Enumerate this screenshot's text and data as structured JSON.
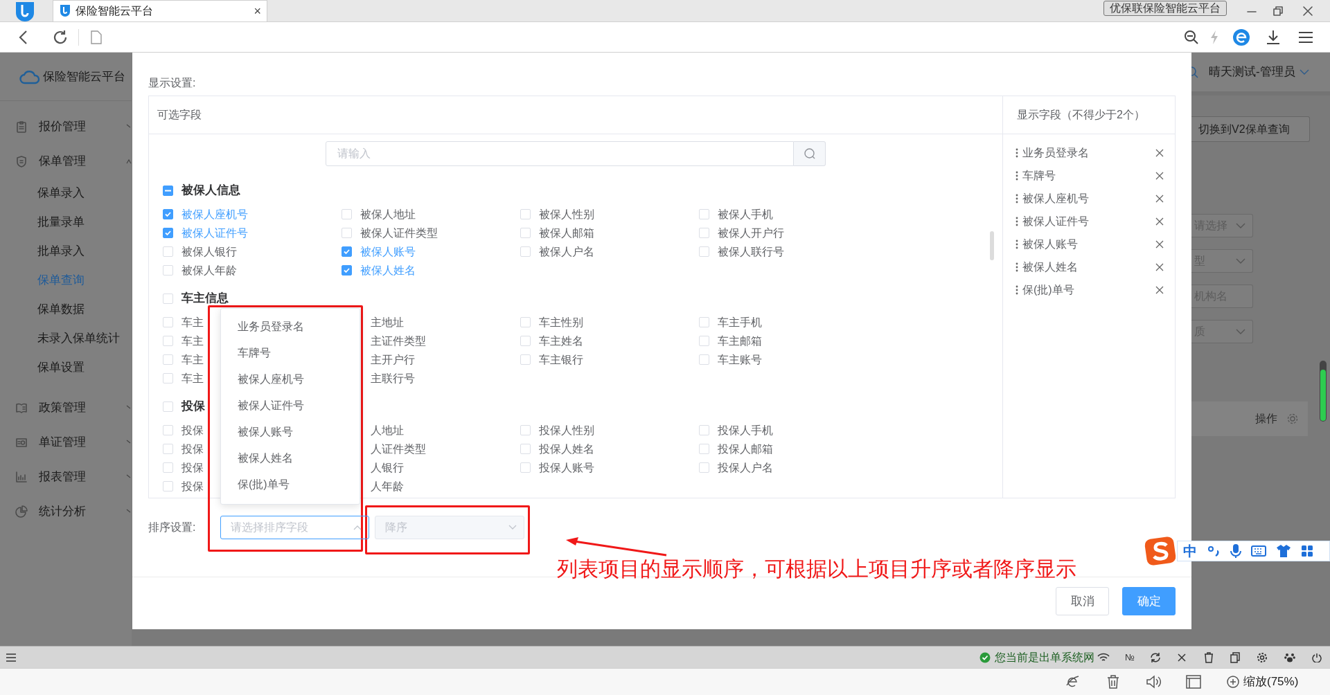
{
  "browser": {
    "tab_title": "保险智能云平台",
    "tab_close": "×",
    "window_label": "优保联保险智能云平台"
  },
  "app": {
    "brand": "保险智能云平台",
    "user": "晴天测试-管理员",
    "switch_button": "切换到V2保单查询",
    "filters": [
      {
        "text": "请选择",
        "kind": "select"
      },
      {
        "text": "型",
        "kind": "select"
      },
      {
        "text": "机构名",
        "kind": "input"
      },
      {
        "text": "质",
        "kind": "select"
      }
    ],
    "table_header": "操作"
  },
  "sidebar": [
    {
      "label": "报价管理",
      "expanded": false
    },
    {
      "label": "保单管理",
      "expanded": true,
      "children": [
        {
          "label": "保单录入",
          "selected": false
        },
        {
          "label": "批量录单",
          "selected": false
        },
        {
          "label": "批单录入",
          "selected": false
        },
        {
          "label": "保单查询",
          "selected": true
        },
        {
          "label": "保单数据",
          "selected": false
        },
        {
          "label": "未录入保单统计",
          "selected": false
        },
        {
          "label": "保单设置",
          "selected": false
        }
      ]
    },
    {
      "label": "政策管理",
      "expanded": false
    },
    {
      "label": "单证管理",
      "expanded": false
    },
    {
      "label": "报表管理",
      "expanded": false
    },
    {
      "label": "统计分析",
      "expanded": false
    }
  ],
  "dialog": {
    "section_label": "显示设置:",
    "available": {
      "title": "可选字段",
      "search_placeholder": "请输入",
      "groups": [
        {
          "label": "被保人信息",
          "indeterminate": true,
          "items": [
            {
              "label": "被保人座机号",
              "checked": true
            },
            {
              "label": "被保人地址",
              "checked": false
            },
            {
              "label": "被保人性别",
              "checked": false
            },
            {
              "label": "被保人手机",
              "checked": false
            },
            {
              "label": "被保人证件号",
              "checked": true
            },
            {
              "label": "被保人证件类型",
              "checked": false
            },
            {
              "label": "被保人邮箱",
              "checked": false
            },
            {
              "label": "被保人开户行",
              "checked": false
            },
            {
              "label": "被保人银行",
              "checked": false
            },
            {
              "label": "被保人账号",
              "checked": true
            },
            {
              "label": "被保人户名",
              "checked": false
            },
            {
              "label": "被保人联行号",
              "checked": false
            },
            {
              "label": "被保人年龄",
              "checked": false
            },
            {
              "label": "被保人姓名",
              "checked": true
            }
          ]
        },
        {
          "label": "车主信息",
          "indeterminate": false,
          "items": [
            {
              "label": "车主",
              "checked": false
            },
            {
              "label": "主地址"
            },
            {
              "label": "车主性别",
              "checked": false
            },
            {
              "label": "车主手机",
              "checked": false
            },
            {
              "label": "车主",
              "checked": false
            },
            {
              "label": "主证件类型"
            },
            {
              "label": "车主姓名",
              "checked": false
            },
            {
              "label": "车主邮箱",
              "checked": false
            },
            {
              "label": "车主",
              "checked": false
            },
            {
              "label": "主开户行"
            },
            {
              "label": "车主银行",
              "checked": false
            },
            {
              "label": "车主账号",
              "checked": false
            },
            {
              "label": "车主",
              "checked": false
            },
            {
              "label": "主联行号"
            }
          ]
        },
        {
          "label": "投保",
          "indeterminate": false,
          "items": [
            {
              "label": "投保",
              "checked": false
            },
            {
              "label": "人地址"
            },
            {
              "label": "投保人性别",
              "checked": false
            },
            {
              "label": "投保人手机",
              "checked": false
            },
            {
              "label": "投保",
              "checked": false
            },
            {
              "label": "人证件类型"
            },
            {
              "label": "投保人姓名",
              "checked": false
            },
            {
              "label": "投保人邮箱",
              "checked": false
            },
            {
              "label": "投保",
              "checked": false
            },
            {
              "label": "人银行"
            },
            {
              "label": "投保人账号",
              "checked": false
            },
            {
              "label": "投保人户名",
              "checked": false
            },
            {
              "label": "投保",
              "checked": false
            },
            {
              "label": "人年龄"
            }
          ]
        }
      ]
    },
    "displayed": {
      "title": "显示字段（不得少于2个）",
      "items": [
        "业务员登录名",
        "车牌号",
        "被保人座机号",
        "被保人证件号",
        "被保人账号",
        "被保人姓名",
        "保(批)单号"
      ]
    },
    "sort": {
      "label": "排序设置:",
      "field_placeholder": "请选择排序字段",
      "field_open": true,
      "order": "降序",
      "order_disabled": true
    },
    "dropdown": [
      "业务员登录名",
      "车牌号",
      "被保人座机号",
      "被保人证件号",
      "被保人账号",
      "被保人姓名",
      "保(批)单号"
    ],
    "buttons": [
      {
        "label": "取消",
        "kind": "default"
      },
      {
        "label": "确定",
        "kind": "primary"
      }
    ]
  },
  "annotation": {
    "text": "列表项目的显示顺序，可根据以上项目升序或者降序显示"
  },
  "ime": {
    "mode": "中"
  },
  "status_bar": {
    "network": "您当前是出单系统网",
    "number_sign": "№"
  },
  "bottom_bar": {
    "zoom": "缩放(75%)"
  }
}
